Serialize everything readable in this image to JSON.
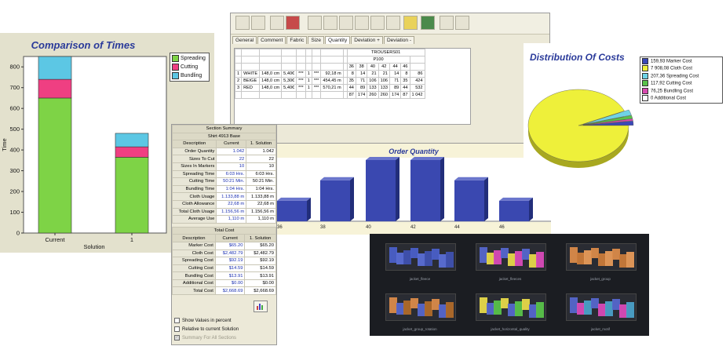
{
  "grid_window": {
    "tabs": [
      "General",
      "Comment",
      "Fabric",
      "Size",
      "Quantity",
      "Deviation +",
      "Deviation -"
    ],
    "model": "TROUSERS01",
    "sub_model": "P100",
    "sizes": [
      "36",
      "38",
      "40",
      "42",
      "44",
      "46"
    ],
    "rows": [
      {
        "n": "1",
        "name": "WHITE",
        "width": "148,0 cm",
        "price": "5,40€",
        "stars": "***",
        "c": "1",
        "stars2": "***",
        "len": "92,18 m",
        "q": [
          "8",
          "14",
          "21",
          "21",
          "14",
          "8"
        ],
        "total": "86"
      },
      {
        "n": "2",
        "name": "BEIGE",
        "width": "148,0 cm",
        "price": "5,30€",
        "stars": "***",
        "c": "1",
        "stars2": "***",
        "len": "454,45 m",
        "q": [
          "35",
          "71",
          "106",
          "106",
          "71",
          "35"
        ],
        "total": "424"
      },
      {
        "n": "3",
        "name": "RED",
        "width": "148,0 cm",
        "price": "5,40€",
        "stars": "***",
        "c": "1",
        "stars2": "***",
        "len": "570,21 m",
        "q": [
          "44",
          "89",
          "133",
          "133",
          "89",
          "44"
        ],
        "total": "532"
      }
    ],
    "totals": [
      "87",
      "174",
      "260",
      "260",
      "174",
      "87"
    ],
    "grand_total": "1 042"
  },
  "times_chart": {
    "title": "Comparison of Times",
    "ylabel": "Time",
    "xlabel": "Solution",
    "yticks": [
      "0",
      "100",
      "200",
      "300",
      "400",
      "500",
      "600",
      "700",
      "800"
    ],
    "legend": [
      "Spreading",
      "Cutting",
      "Bundling"
    ],
    "colors": {
      "spreading": "#7ed346",
      "cutting": "#ef3f82",
      "bundling": "#5cc7e4"
    }
  },
  "summary": {
    "section_title": "Section Summary",
    "shirt_title": "Shirt 4913 Base",
    "col_desc": "Description",
    "col_current": "Current",
    "col_solution": "1. Solution",
    "rows": [
      {
        "label": "Order Quantity",
        "current": "1.042",
        "solution": "1.042"
      },
      {
        "label": "Sizes To Cut",
        "current": "22",
        "solution": "22"
      },
      {
        "label": "Sizes In Markers",
        "current": "10",
        "solution": "10"
      },
      {
        "label": "Spreading Time",
        "current": "6:03 Hrs.",
        "solution": "6:03 Hrs."
      },
      {
        "label": "Cutting Time",
        "current": "50:21 Min.",
        "solution": "50:21 Min."
      },
      {
        "label": "Bundling Time",
        "current": "1:04 Hrs.",
        "solution": "1:04 Hrs."
      },
      {
        "label": "Cloth Usage",
        "current": "1.133,88 m",
        "solution": "1.133,88 m"
      },
      {
        "label": "Cloth Allowance",
        "current": "22,68 m",
        "solution": "22,68 m"
      },
      {
        "label": "Total Cloth Usage",
        "current": "1.156,56 m",
        "solution": "1.156,56 m"
      },
      {
        "label": "Average Use",
        "current": "1,110 m",
        "solution": "1,110 m"
      }
    ],
    "total_cost_title": "Total Cost",
    "cost_rows": [
      {
        "label": "Marker Cost",
        "current": "$65.20",
        "solution": "$65.20"
      },
      {
        "label": "Cloth Cost",
        "current": "$2,482.79",
        "solution": "$2,482.79"
      },
      {
        "label": "Spreading Cost",
        "current": "$92.19",
        "solution": "$92.19"
      },
      {
        "label": "Cutting Cost",
        "current": "$14.59",
        "solution": "$14.59"
      },
      {
        "label": "Bundling Cost",
        "current": "$13.91",
        "solution": "$13.91"
      },
      {
        "label": "Additional Cost",
        "current": "$0.00",
        "solution": "$0.00"
      },
      {
        "label": "Total Cost",
        "current": "$2,668.69",
        "solution": "$2,668.69"
      }
    ],
    "options": [
      {
        "label": "Show Values in percent",
        "checked": false
      },
      {
        "label": "Relative to current Solution",
        "checked": false
      },
      {
        "label": "Summary For All Sections",
        "checked": true
      }
    ]
  },
  "order_chart": {
    "title": "Order Quantity",
    "color": "#3a48b0"
  },
  "pie_chart": {
    "title": "Distribution Of Costs",
    "legend": [
      {
        "label": "159,93 Marker Cost",
        "color": "#3b49b8"
      },
      {
        "label": "7 908,08 Cloth Cost",
        "color": "#eef03a"
      },
      {
        "label": "207,36 Spreading Cost",
        "color": "#6fd3e6"
      },
      {
        "label": "117,92 Cutting Cost",
        "color": "#58c24a"
      },
      {
        "label": "76,25 Bundling Cost",
        "color": "#d94ab0"
      },
      {
        "label": "0 Additional Cost",
        "color": "#ffffff"
      }
    ]
  },
  "markers": {
    "tiles": [
      "jacket_fleece",
      "jacket_fleeces",
      "jacket_group",
      "jacket_group_rotation",
      "jacket_horizontal_quality",
      "jacket_motif"
    ]
  },
  "chart_data": [
    {
      "type": "bar",
      "title": "Comparison of Times",
      "xlabel": "Solution",
      "ylabel": "Time",
      "categories": [
        "Current",
        "1"
      ],
      "stacked": true,
      "ylim": [
        0,
        850
      ],
      "grid": false,
      "legend_position": "right",
      "series": [
        {
          "name": "Spreading",
          "values": [
            650,
            365
          ],
          "color": "#7ed346"
        },
        {
          "name": "Cutting",
          "values": [
            90,
            50
          ],
          "color": "#ef3f82"
        },
        {
          "name": "Bundling",
          "values": [
            110,
            65
          ],
          "color": "#5cc7e4"
        }
      ]
    },
    {
      "type": "bar",
      "title": "Order Quantity",
      "categories": [
        "36",
        "38",
        "40",
        "42",
        "44",
        "46"
      ],
      "values": [
        87,
        174,
        260,
        260,
        174,
        87
      ],
      "ylim": [
        0,
        270
      ],
      "color": "#3a48b0"
    },
    {
      "type": "pie",
      "title": "Distribution Of Costs",
      "categories": [
        "Marker Cost",
        "Cloth Cost",
        "Spreading Cost",
        "Cutting Cost",
        "Bundling Cost",
        "Additional Cost"
      ],
      "values": [
        159.93,
        7908.08,
        207.36,
        117.92,
        76.25,
        0
      ],
      "colors": [
        "#3b49b8",
        "#eef03a",
        "#6fd3e6",
        "#58c24a",
        "#d94ab0",
        "#ffffff"
      ],
      "legend_position": "right"
    }
  ]
}
